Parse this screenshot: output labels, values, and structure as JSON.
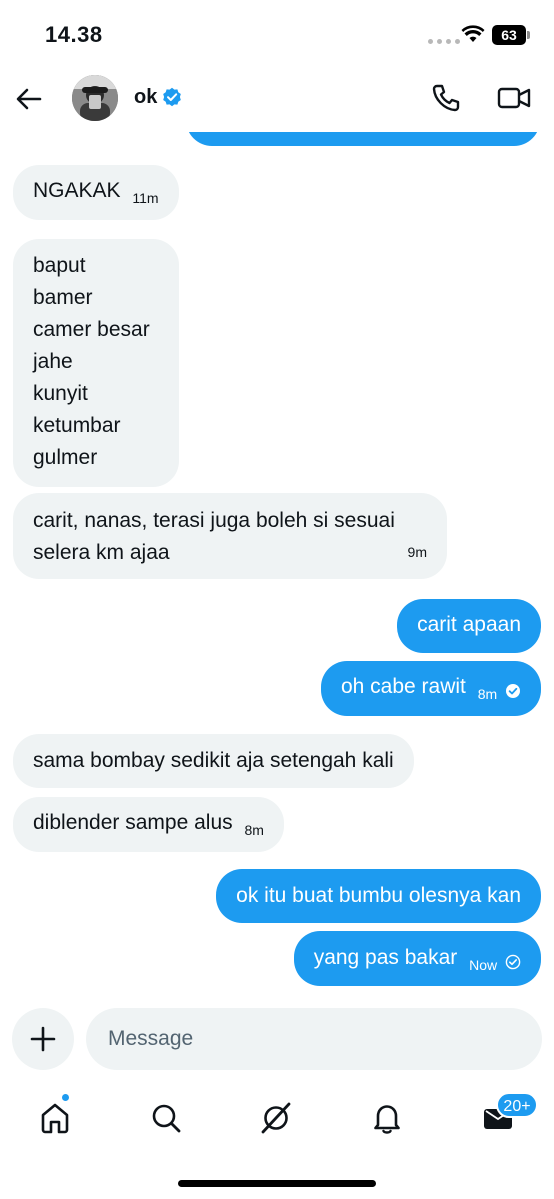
{
  "status_bar": {
    "time": "14.38",
    "battery": "63"
  },
  "header": {
    "contact_name": "ok"
  },
  "messages": [
    {
      "side": "in",
      "text": "NGAKAK",
      "time": "11m"
    },
    {
      "side": "in",
      "text": "baput\nbamer\ncamer besar\njahe\nkunyit\nketumbar\ngulmer",
      "time": ""
    },
    {
      "side": "in",
      "text": "carit, nanas, terasi juga boleh si sesuai\nselera km ajaa",
      "time": "9m"
    },
    {
      "side": "out",
      "text": "carit apaan",
      "time": ""
    },
    {
      "side": "out",
      "text": "oh cabe rawit",
      "time": "8m",
      "read": true
    },
    {
      "side": "in",
      "text": "sama bombay sedikit aja setengah kali",
      "time": ""
    },
    {
      "side": "in",
      "text": "diblender sampe alus",
      "time": "8m"
    },
    {
      "side": "out",
      "text": "ok itu buat bumbu olesnya kan",
      "time": ""
    },
    {
      "side": "out",
      "text": "yang pas bakar",
      "time": "Now",
      "read": false
    }
  ],
  "composer": {
    "placeholder": "Message"
  },
  "nav": {
    "items": [
      {
        "name": "home",
        "icon": "home-icon",
        "active": true,
        "dot": true
      },
      {
        "name": "explore",
        "icon": "search-icon"
      },
      {
        "name": "grok",
        "icon": "grok-icon"
      },
      {
        "name": "notifications",
        "icon": "bell-icon"
      },
      {
        "name": "messages",
        "icon": "envelope-icon",
        "badge": "20+"
      }
    ]
  },
  "colors": {
    "accent": "#1d9bf0",
    "incoming_bubble": "#eff3f4",
    "text": "#0f1419",
    "placeholder": "#536471"
  }
}
